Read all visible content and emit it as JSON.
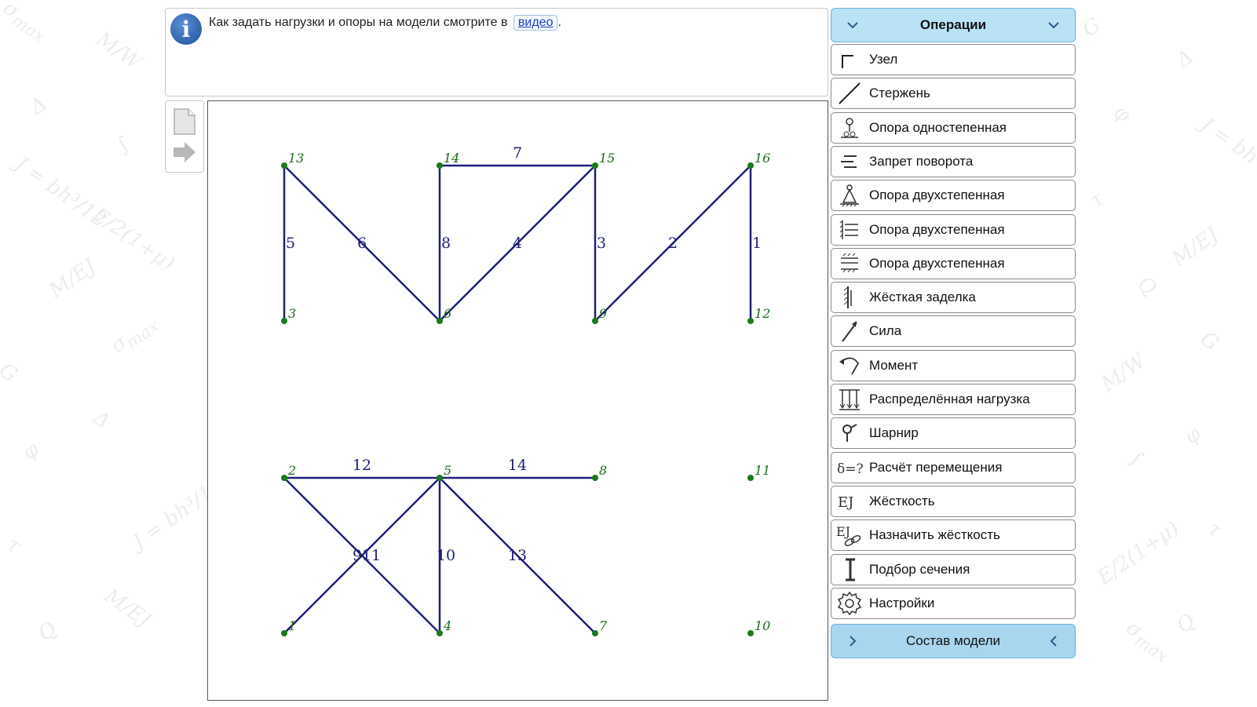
{
  "info": {
    "text": "Как задать нагрузки и опоры на модели смотрите в",
    "link": "видео",
    "suffix": "."
  },
  "operations": {
    "header": "Операции",
    "items": [
      {
        "label": "Узел",
        "icon": "node-icon"
      },
      {
        "label": "Стержень",
        "icon": "rod-icon"
      },
      {
        "label": "Опора одностепенная",
        "icon": "single-support-icon"
      },
      {
        "label": "Запрет поворота",
        "icon": "rotation-lock-icon"
      },
      {
        "label": "Опора двухстепенная",
        "icon": "pin-support-icon"
      },
      {
        "label": "Опора двухстепенная",
        "icon": "side-support-icon"
      },
      {
        "label": "Опора двухстепенная",
        "icon": "slider-support-icon"
      },
      {
        "label": "Жёсткая заделка",
        "icon": "fixed-support-icon"
      },
      {
        "label": "Сила",
        "icon": "force-icon"
      },
      {
        "label": "Момент",
        "icon": "moment-icon"
      },
      {
        "label": "Распределённая нагрузка",
        "icon": "distributed-load-icon"
      },
      {
        "label": "Шарнир",
        "icon": "hinge-icon"
      },
      {
        "label": "Расчёт перемещения",
        "icon": "displacement-icon"
      },
      {
        "label": "Жёсткость",
        "icon": "stiffness-icon"
      },
      {
        "label": "Назначить жёсткость",
        "icon": "assign-stiffness-icon"
      },
      {
        "label": "Подбор сечения",
        "icon": "section-icon"
      },
      {
        "label": "Настройки",
        "icon": "settings-icon"
      }
    ]
  },
  "model": {
    "header": "Состав модели"
  },
  "truss": {
    "nodes": [
      {
        "id": "1"
      },
      {
        "id": "2"
      },
      {
        "id": "3"
      },
      {
        "id": "4"
      },
      {
        "id": "5"
      },
      {
        "id": "6"
      },
      {
        "id": "7"
      },
      {
        "id": "8"
      },
      {
        "id": "9"
      },
      {
        "id": "10"
      },
      {
        "id": "11"
      },
      {
        "id": "12"
      },
      {
        "id": "13"
      },
      {
        "id": "14"
      },
      {
        "id": "15"
      },
      {
        "id": "16"
      }
    ],
    "rods": [
      {
        "id": "1",
        "from": "16",
        "to": "12"
      },
      {
        "id": "2",
        "from": "16",
        "to": "9"
      },
      {
        "id": "3",
        "from": "15",
        "to": "9"
      },
      {
        "id": "4",
        "from": "15",
        "to": "6"
      },
      {
        "id": "5",
        "from": "13",
        "to": "3"
      },
      {
        "id": "6",
        "from": "13",
        "to": "6"
      },
      {
        "id": "7",
        "from": "14",
        "to": "15"
      },
      {
        "id": "8",
        "from": "14",
        "to": "6"
      },
      {
        "id": "9",
        "from": "1",
        "to": "5"
      },
      {
        "id": "10",
        "from": "5",
        "to": "4"
      },
      {
        "id": "11",
        "from": "2",
        "to": "4"
      },
      {
        "id": "12",
        "from": "2",
        "to": "5"
      },
      {
        "id": "13",
        "from": "5",
        "to": "7"
      },
      {
        "id": "14",
        "from": "5",
        "to": "8"
      }
    ],
    "colors": {
      "rod": "#1f1f7a",
      "node": "#1a7a1a",
      "node_label": "#1a6a1a",
      "rod_label": "#1f1f7a"
    }
  },
  "colors": {
    "header_bg": "#b9e2f5",
    "header_border": "#6ab0d8"
  }
}
